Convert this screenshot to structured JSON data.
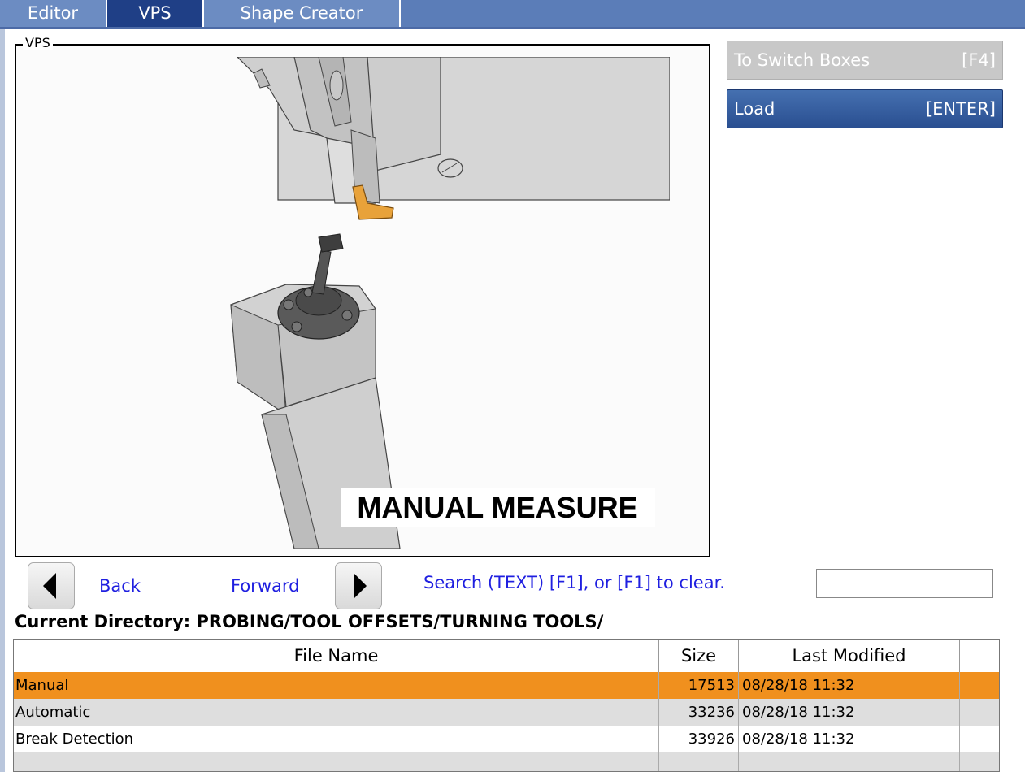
{
  "tabs": [
    {
      "label": "Editor"
    },
    {
      "label": "VPS"
    },
    {
      "label": "Shape Creator"
    }
  ],
  "vps": {
    "legend": "VPS",
    "illustration_caption": "MANUAL MEASURE"
  },
  "buttons": {
    "switch_label": "To Switch Boxes",
    "switch_key": "[F4]",
    "load_label": "Load",
    "load_key": "[ENTER]"
  },
  "nav": {
    "back_label": "Back",
    "forward_label": "Forward",
    "search_hint": "Search (TEXT) [F1], or [F1] to clear.",
    "search_value": ""
  },
  "current_directory": "Current Directory: PROBING/TOOL OFFSETS/TURNING TOOLS/",
  "table": {
    "headers": [
      "File Name",
      "Size",
      "Last Modified",
      ""
    ],
    "rows": [
      {
        "name": "Manual",
        "size": "17513",
        "modified": "08/28/18 11:32",
        "selected": true
      },
      {
        "name": "Automatic",
        "size": "33236",
        "modified": "08/28/18 11:32",
        "selected": false
      },
      {
        "name": "Break Detection",
        "size": "33926",
        "modified": "08/28/18 11:32",
        "selected": false
      },
      {
        "name": "",
        "size": "",
        "modified": "",
        "selected": false
      }
    ]
  },
  "colors": {
    "tab_bar": "#5b7db8",
    "tab_active": "#1f3f86",
    "selected_row": "#f0901e",
    "link_blue": "#1f1fe0",
    "tool_insert": "#e8a23a"
  }
}
